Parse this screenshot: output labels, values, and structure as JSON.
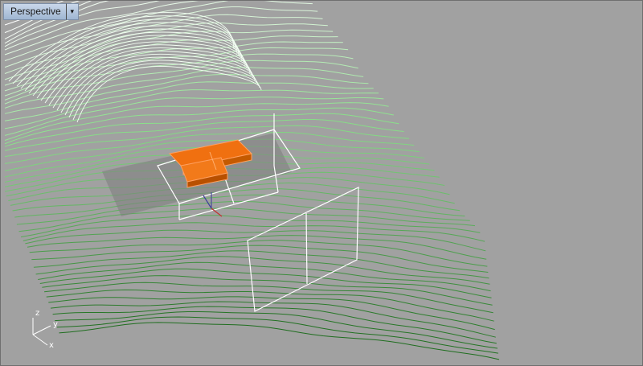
{
  "viewport": {
    "name": "Perspective",
    "dropdown_glyph": "▾",
    "background": "#a1a1a1"
  },
  "axes_widget": {
    "z_label": "z",
    "y_label": "y",
    "x_label": "x"
  },
  "colors": {
    "terrain_light": "#ffffff",
    "terrain_mid": "#8be08b",
    "terrain_dark": "#1f6e1f",
    "selected_object": "#f07010",
    "frame_lines": "#ffffff"
  },
  "icons": {
    "dropdown": "chevron-down-icon",
    "axis_widget": "axes-icon"
  }
}
